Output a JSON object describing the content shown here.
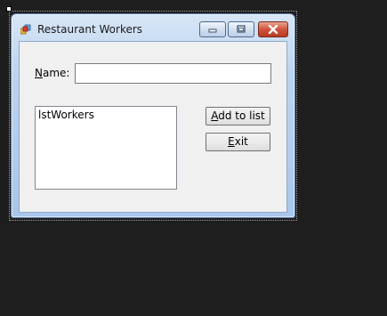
{
  "window": {
    "title": "Restaurant Workers",
    "app_icon": "form-icon"
  },
  "caption_buttons": {
    "minimize_icon": "minimize-icon",
    "maximize_icon": "maximize-icon",
    "close_icon": "close-icon"
  },
  "form": {
    "name_label": "Name:",
    "name_label_mnemonic": "N",
    "name_label_rest": "ame:",
    "name_value": "",
    "list_label": "lstWorkers",
    "add_button_mnemonic": "A",
    "add_button_rest": "dd to list",
    "add_button_label": "Add to list",
    "exit_button_mnemonic": "E",
    "exit_button_rest": "xit",
    "exit_button_label": "Exit"
  },
  "colors": {
    "background": "#1e1e1e",
    "client": "#f0f0f0",
    "close_button": "#c84a32"
  }
}
